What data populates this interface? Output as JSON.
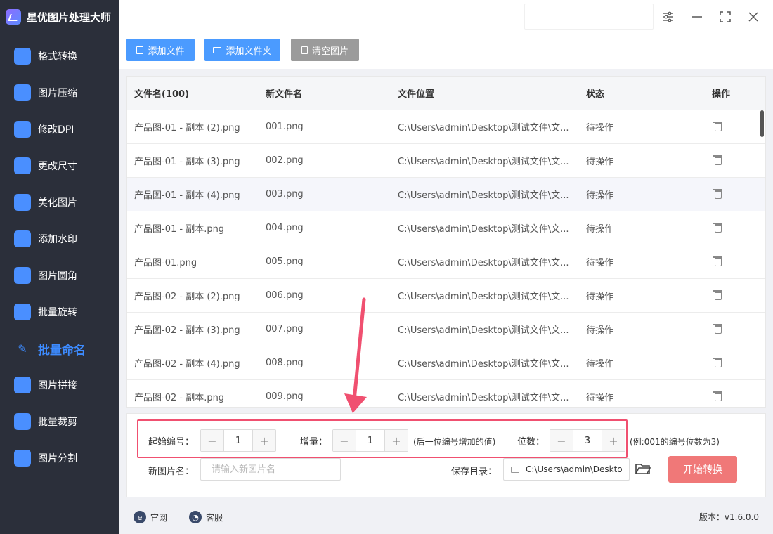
{
  "app": {
    "title": "星优图片处理大师"
  },
  "sidebar": {
    "items": [
      {
        "label": "格式转换",
        "icon": "image-convert-icon",
        "color": "#4a8fff"
      },
      {
        "label": "图片压缩",
        "icon": "image-compress-icon",
        "color": "#4a8fff"
      },
      {
        "label": "修改DPI",
        "icon": "dpi-icon",
        "color": "#4a8fff"
      },
      {
        "label": "更改尺寸",
        "icon": "resize-icon",
        "color": "#4a8fff"
      },
      {
        "label": "美化图片",
        "icon": "beautify-icon",
        "color": "#4a8fff"
      },
      {
        "label": "添加水印",
        "icon": "watermark-icon",
        "color": "#4a8fff"
      },
      {
        "label": "图片圆角",
        "icon": "round-corner-icon",
        "color": "#4a8fff"
      },
      {
        "label": "批量旋转",
        "icon": "rotate-icon",
        "color": "#4a8fff"
      },
      {
        "label": "批量命名",
        "icon": "rename-icon",
        "color": "#3d8bff",
        "active": true
      },
      {
        "label": "图片拼接",
        "icon": "stitch-icon",
        "color": "#4a8fff"
      },
      {
        "label": "批量裁剪",
        "icon": "crop-icon",
        "color": "#4a8fff"
      },
      {
        "label": "图片分割",
        "icon": "split-icon",
        "color": "#4a8fff"
      }
    ]
  },
  "toolbar": {
    "add_file": "添加文件",
    "add_folder": "添加文件夹",
    "clear_images": "清空图片"
  },
  "table": {
    "headers": [
      "文件名(100)",
      "新文件名",
      "文件位置",
      "状态",
      "操作"
    ],
    "rows": [
      [
        "产品图-01 - 副本 (2).png",
        "001.png",
        "C:\\Users\\admin\\Desktop\\测试文件\\文...",
        "待操作"
      ],
      [
        "产品图-01 - 副本 (3).png",
        "002.png",
        "C:\\Users\\admin\\Desktop\\测试文件\\文...",
        "待操作"
      ],
      [
        "产品图-01 - 副本 (4).png",
        "003.png",
        "C:\\Users\\admin\\Desktop\\测试文件\\文...",
        "待操作"
      ],
      [
        "产品图-01 - 副本.png",
        "004.png",
        "C:\\Users\\admin\\Desktop\\测试文件\\文...",
        "待操作"
      ],
      [
        "产品图-01.png",
        "005.png",
        "C:\\Users\\admin\\Desktop\\测试文件\\文...",
        "待操作"
      ],
      [
        "产品图-02 - 副本 (2).png",
        "006.png",
        "C:\\Users\\admin\\Desktop\\测试文件\\文...",
        "待操作"
      ],
      [
        "产品图-02 - 副本 (3).png",
        "007.png",
        "C:\\Users\\admin\\Desktop\\测试文件\\文...",
        "待操作"
      ],
      [
        "产品图-02 - 副本 (4).png",
        "008.png",
        "C:\\Users\\admin\\Desktop\\测试文件\\文...",
        "待操作"
      ],
      [
        "产品图-02 - 副本.png",
        "009.png",
        "C:\\Users\\admin\\Desktop\\测试文件\\文...",
        "待操作"
      ]
    ]
  },
  "settings": {
    "start_label": "起始编号：",
    "start_value": "1",
    "increment_label": "增量：",
    "increment_value": "1",
    "increment_hint": "(后一位编号增加的值)",
    "digits_label": "位数：",
    "digits_value": "3",
    "digits_hint": "(例:001的编号位数为3)",
    "minus": "−",
    "plus": "+",
    "new_name_label": "新图片名：",
    "new_name_placeholder": "请输入新图片名",
    "save_dir_label": "保存目录：",
    "save_dir_value": "C:\\Users\\admin\\Deskto",
    "start_button": "开始转换"
  },
  "footer": {
    "website": "官网",
    "support": "客服",
    "version": "版本：v1.6.0.0"
  },
  "colors": {
    "sidebar_bg": "#2b2f3a",
    "accent": "#4b9bff",
    "start_button": "#f07878",
    "highlight_box": "#f05070"
  }
}
